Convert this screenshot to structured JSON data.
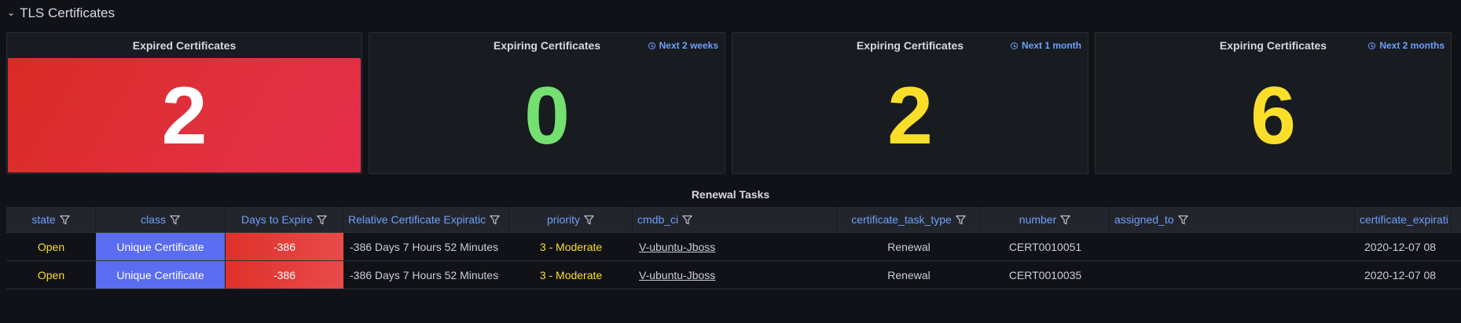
{
  "row": {
    "title": "TLS Certificates"
  },
  "panels": [
    {
      "title": "Expired Certificates",
      "value": "2",
      "time_label": ""
    },
    {
      "title": "Expiring Certificates",
      "value": "0",
      "time_label": "Next 2 weeks"
    },
    {
      "title": "Expiring Certificates",
      "value": "2",
      "time_label": "Next 1 month"
    },
    {
      "title": "Expiring Certificates",
      "value": "6",
      "time_label": "Next 2 months"
    }
  ],
  "colors": {
    "expired_bg": "#e0303e",
    "green": "#73e06f",
    "yellow": "#fade2a",
    "class_bg": "#5a6cf0",
    "header_text": "#6e9fff"
  },
  "table": {
    "title": "Renewal Tasks",
    "columns": [
      "state",
      "class",
      "Days to Expire",
      "Relative Certificate Expiratic",
      "priority",
      "cmdb_ci",
      "certificate_task_type",
      "number",
      "assigned_to",
      "certificate_expirati"
    ],
    "rows": [
      {
        "state": "Open",
        "class": "Unique Certificate",
        "days": "-386",
        "relative": "-386 Days 7 Hours 52 Minutes",
        "priority": "3 - Moderate",
        "cmdb_ci": "V-ubuntu-Jboss",
        "task_type": "Renewal",
        "number": "CERT0010051",
        "assigned_to": "",
        "expiration": "2020-12-07 08"
      },
      {
        "state": "Open",
        "class": "Unique Certificate",
        "days": "-386",
        "relative": "-386 Days 7 Hours 52 Minutes",
        "priority": "3 - Moderate",
        "cmdb_ci": "V-ubuntu-Jboss",
        "task_type": "Renewal",
        "number": "CERT0010035",
        "assigned_to": "",
        "expiration": "2020-12-07 08"
      }
    ]
  }
}
